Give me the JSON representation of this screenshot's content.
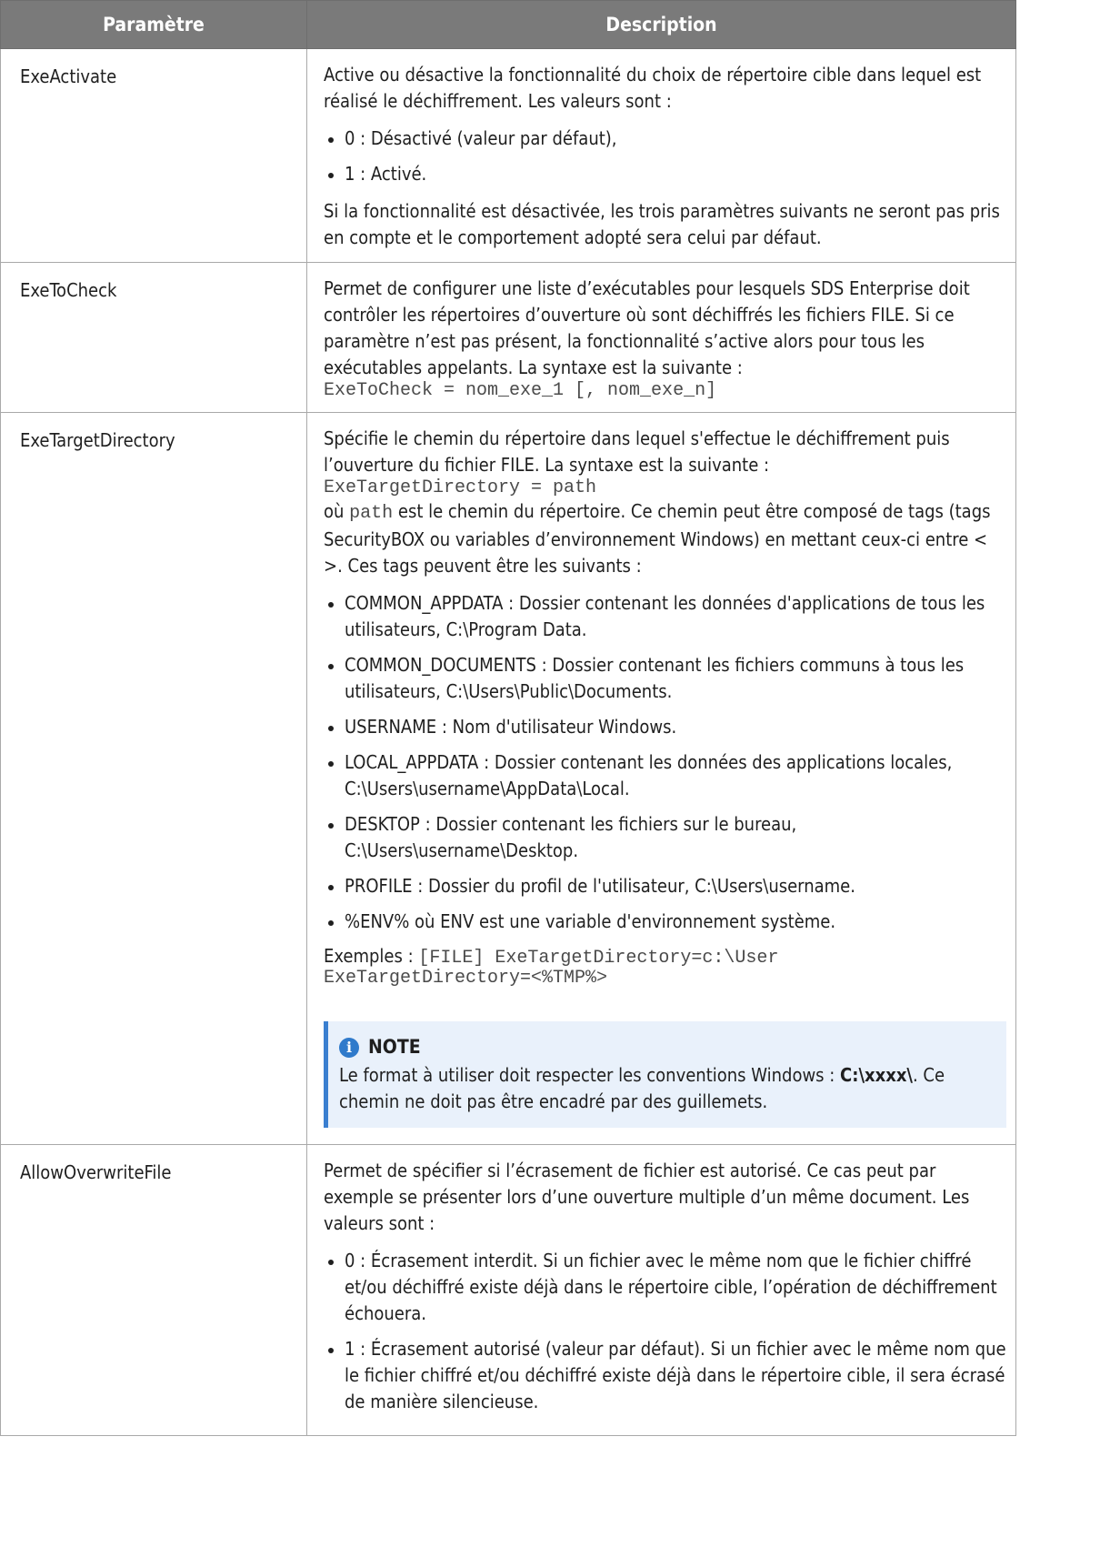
{
  "table": {
    "header": {
      "param": "Paramètre",
      "desc": "Description"
    },
    "rows": [
      {
        "name": "ExeActivate",
        "intro": "Active ou désactive la fonctionnalité du choix de répertoire cible dans lequel est réalisé le déchiffrement. Les valeurs sont :",
        "bullets": [
          "0 : Désactivé (valeur par défaut),",
          "1 : Activé."
        ],
        "outro": "Si la fonctionnalité est désactivée, les trois paramètres suivants ne seront pas pris en compte et le comportement adopté sera celui par défaut."
      },
      {
        "name": "ExeToCheck",
        "intro": "Permet de configurer une liste d’exécutables pour lesquels SDS Enterprise doit contrôler les répertoires d’ouverture où sont déchiffrés les fichiers FILE. Si ce paramètre n’est pas présent, la fonctionnalité s’active alors pour tous les exécutables appelants. La syntaxe est la suivante :",
        "code": "ExeToCheck = nom_exe_1 [, nom_exe_n]"
      },
      {
        "name": "ExeTargetDirectory",
        "intro": "Spécifie le chemin du répertoire dans lequel s'effectue le déchiffrement puis l’ouverture du fichier FILE. La syntaxe est la suivante :",
        "code": "ExeTargetDirectory = path",
        "path_prefix": "où",
        "path_word": "path",
        "path_suffix": "est le chemin du répertoire. Ce chemin peut être composé de tags (tags SecurityBOX ou variables d’environnement Windows) en mettant ceux-ci entre < >. Ces tags peuvent être les suivants :",
        "bullets": [
          "COMMON_APPDATA : Dossier contenant les données d'applications de tous les utilisateurs, C:\\Program Data.",
          "COMMON_DOCUMENTS : Dossier contenant les fichiers communs à tous les utilisateurs, C:\\Users\\Public\\Documents.",
          "USERNAME : Nom d'utilisateur Windows.",
          "LOCAL_APPDATA : Dossier contenant les données des applications locales, C:\\Users\\username\\AppData\\Local.",
          "DESKTOP : Dossier contenant les fichiers sur le bureau, C:\\Users\\username\\Desktop.",
          "PROFILE : Dossier du profil de l'utilisateur, C:\\Users\\username.",
          "%ENV% où ENV est une variable d'environnement système."
        ],
        "examples_label": "Exemples :",
        "example_1": "[FILE] ExeTargetDirectory=c:\\User",
        "example_2": "ExeTargetDirectory=<%TMP%>",
        "note": {
          "icon": "info-icon",
          "title": "NOTE",
          "text_before": "Le format à utiliser doit respecter les conventions Windows :",
          "text_bold": "C:\\xxxx\\",
          "text_after": ". Ce chemin ne doit pas être encadré par des guillemets."
        }
      },
      {
        "name": "AllowOverwriteFile",
        "intro": "Permet de spécifier si l’écrasement de fichier est autorisé. Ce cas peut par exemple se présenter lors d’une ouverture multiple d’un même document. Les valeurs sont :",
        "bullets": [
          "0 : Écrasement interdit. Si un fichier avec le même nom que le fichier chiffré et/ou déchiffré existe déjà dans le répertoire cible, l’opération de déchiffrement échouera.",
          "1 : Écrasement autorisé (valeur par défaut). Si un fichier avec le même nom que le fichier chiffré et/ou déchiffré existe déjà dans le répertoire cible, il sera écrasé de manière silencieuse."
        ]
      }
    ]
  }
}
